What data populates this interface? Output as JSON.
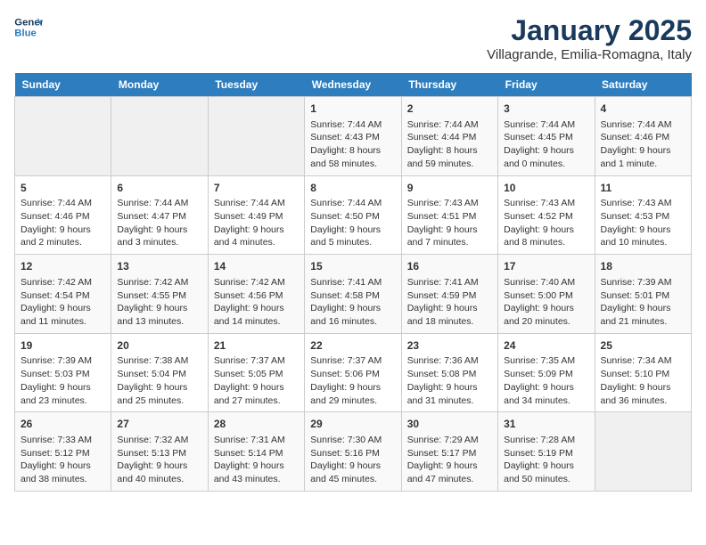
{
  "logo": {
    "line1": "General",
    "line2": "Blue"
  },
  "title": "January 2025",
  "location": "Villagrande, Emilia-Romagna, Italy",
  "days_of_week": [
    "Sunday",
    "Monday",
    "Tuesday",
    "Wednesday",
    "Thursday",
    "Friday",
    "Saturday"
  ],
  "weeks": [
    [
      {
        "day": "",
        "content": ""
      },
      {
        "day": "",
        "content": ""
      },
      {
        "day": "",
        "content": ""
      },
      {
        "day": "1",
        "content": "Sunrise: 7:44 AM\nSunset: 4:43 PM\nDaylight: 8 hours and 58 minutes."
      },
      {
        "day": "2",
        "content": "Sunrise: 7:44 AM\nSunset: 4:44 PM\nDaylight: 8 hours and 59 minutes."
      },
      {
        "day": "3",
        "content": "Sunrise: 7:44 AM\nSunset: 4:45 PM\nDaylight: 9 hours and 0 minutes."
      },
      {
        "day": "4",
        "content": "Sunrise: 7:44 AM\nSunset: 4:46 PM\nDaylight: 9 hours and 1 minute."
      }
    ],
    [
      {
        "day": "5",
        "content": "Sunrise: 7:44 AM\nSunset: 4:46 PM\nDaylight: 9 hours and 2 minutes."
      },
      {
        "day": "6",
        "content": "Sunrise: 7:44 AM\nSunset: 4:47 PM\nDaylight: 9 hours and 3 minutes."
      },
      {
        "day": "7",
        "content": "Sunrise: 7:44 AM\nSunset: 4:49 PM\nDaylight: 9 hours and 4 minutes."
      },
      {
        "day": "8",
        "content": "Sunrise: 7:44 AM\nSunset: 4:50 PM\nDaylight: 9 hours and 5 minutes."
      },
      {
        "day": "9",
        "content": "Sunrise: 7:43 AM\nSunset: 4:51 PM\nDaylight: 9 hours and 7 minutes."
      },
      {
        "day": "10",
        "content": "Sunrise: 7:43 AM\nSunset: 4:52 PM\nDaylight: 9 hours and 8 minutes."
      },
      {
        "day": "11",
        "content": "Sunrise: 7:43 AM\nSunset: 4:53 PM\nDaylight: 9 hours and 10 minutes."
      }
    ],
    [
      {
        "day": "12",
        "content": "Sunrise: 7:42 AM\nSunset: 4:54 PM\nDaylight: 9 hours and 11 minutes."
      },
      {
        "day": "13",
        "content": "Sunrise: 7:42 AM\nSunset: 4:55 PM\nDaylight: 9 hours and 13 minutes."
      },
      {
        "day": "14",
        "content": "Sunrise: 7:42 AM\nSunset: 4:56 PM\nDaylight: 9 hours and 14 minutes."
      },
      {
        "day": "15",
        "content": "Sunrise: 7:41 AM\nSunset: 4:58 PM\nDaylight: 9 hours and 16 minutes."
      },
      {
        "day": "16",
        "content": "Sunrise: 7:41 AM\nSunset: 4:59 PM\nDaylight: 9 hours and 18 minutes."
      },
      {
        "day": "17",
        "content": "Sunrise: 7:40 AM\nSunset: 5:00 PM\nDaylight: 9 hours and 20 minutes."
      },
      {
        "day": "18",
        "content": "Sunrise: 7:39 AM\nSunset: 5:01 PM\nDaylight: 9 hours and 21 minutes."
      }
    ],
    [
      {
        "day": "19",
        "content": "Sunrise: 7:39 AM\nSunset: 5:03 PM\nDaylight: 9 hours and 23 minutes."
      },
      {
        "day": "20",
        "content": "Sunrise: 7:38 AM\nSunset: 5:04 PM\nDaylight: 9 hours and 25 minutes."
      },
      {
        "day": "21",
        "content": "Sunrise: 7:37 AM\nSunset: 5:05 PM\nDaylight: 9 hours and 27 minutes."
      },
      {
        "day": "22",
        "content": "Sunrise: 7:37 AM\nSunset: 5:06 PM\nDaylight: 9 hours and 29 minutes."
      },
      {
        "day": "23",
        "content": "Sunrise: 7:36 AM\nSunset: 5:08 PM\nDaylight: 9 hours and 31 minutes."
      },
      {
        "day": "24",
        "content": "Sunrise: 7:35 AM\nSunset: 5:09 PM\nDaylight: 9 hours and 34 minutes."
      },
      {
        "day": "25",
        "content": "Sunrise: 7:34 AM\nSunset: 5:10 PM\nDaylight: 9 hours and 36 minutes."
      }
    ],
    [
      {
        "day": "26",
        "content": "Sunrise: 7:33 AM\nSunset: 5:12 PM\nDaylight: 9 hours and 38 minutes."
      },
      {
        "day": "27",
        "content": "Sunrise: 7:32 AM\nSunset: 5:13 PM\nDaylight: 9 hours and 40 minutes."
      },
      {
        "day": "28",
        "content": "Sunrise: 7:31 AM\nSunset: 5:14 PM\nDaylight: 9 hours and 43 minutes."
      },
      {
        "day": "29",
        "content": "Sunrise: 7:30 AM\nSunset: 5:16 PM\nDaylight: 9 hours and 45 minutes."
      },
      {
        "day": "30",
        "content": "Sunrise: 7:29 AM\nSunset: 5:17 PM\nDaylight: 9 hours and 47 minutes."
      },
      {
        "day": "31",
        "content": "Sunrise: 7:28 AM\nSunset: 5:19 PM\nDaylight: 9 hours and 50 minutes."
      },
      {
        "day": "",
        "content": ""
      }
    ]
  ]
}
